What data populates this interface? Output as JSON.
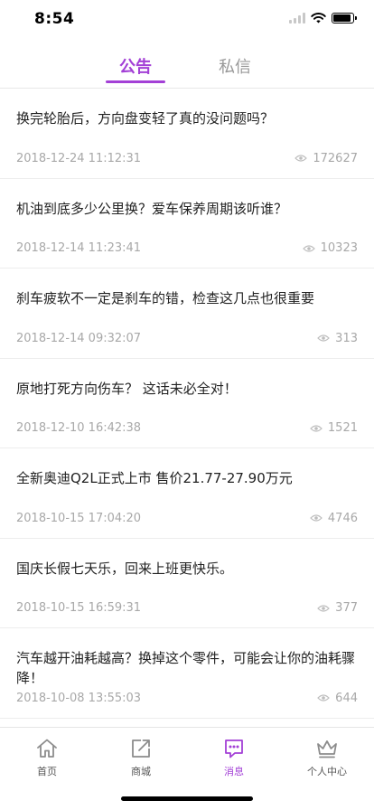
{
  "status": {
    "time": "8:54",
    "battery_level": 0.9
  },
  "tabs": [
    {
      "label": "公告",
      "active": true
    },
    {
      "label": "私信",
      "active": false
    }
  ],
  "articles": [
    {
      "title": "换完轮胎后，方向盘变轻了真的没问题吗？",
      "date": "2018-12-24 11:12:31",
      "views": "172627"
    },
    {
      "title": "机油到底多少公里换？爱车保养周期该听谁？",
      "date": "2018-12-14 11:23:41",
      "views": "10323"
    },
    {
      "title": "刹车疲软不一定是刹车的错，检查这几点也很重要",
      "date": "2018-12-14 09:32:07",
      "views": "313"
    },
    {
      "title": "原地打死方向伤车？ 这话未必全对！",
      "date": "2018-12-10 16:42:38",
      "views": "1521"
    },
    {
      "title": "全新奥迪Q2L正式上市 售价21.77-27.90万元",
      "date": "2018-10-15 17:04:20",
      "views": "4746"
    },
    {
      "title": "国庆长假七天乐，回来上班更快乐。",
      "date": "2018-10-15 16:59:31",
      "views": "377"
    },
    {
      "title": "汽车越开油耗越高？换掉这个零件，可能会让你的油耗骤降！",
      "date": "2018-10-08 13:55:03",
      "views": "644"
    }
  ],
  "tabbar": [
    {
      "label": "首页",
      "icon": "home-icon",
      "active": false
    },
    {
      "label": "商城",
      "icon": "external-link-icon",
      "active": false
    },
    {
      "label": "消息",
      "icon": "message-icon",
      "active": true
    },
    {
      "label": "个人中心",
      "icon": "crown-icon",
      "active": false
    }
  ],
  "colors": {
    "accent": "#a340d6",
    "muted": "#a8a8a8",
    "inactive_icon": "#8c8c8c"
  }
}
